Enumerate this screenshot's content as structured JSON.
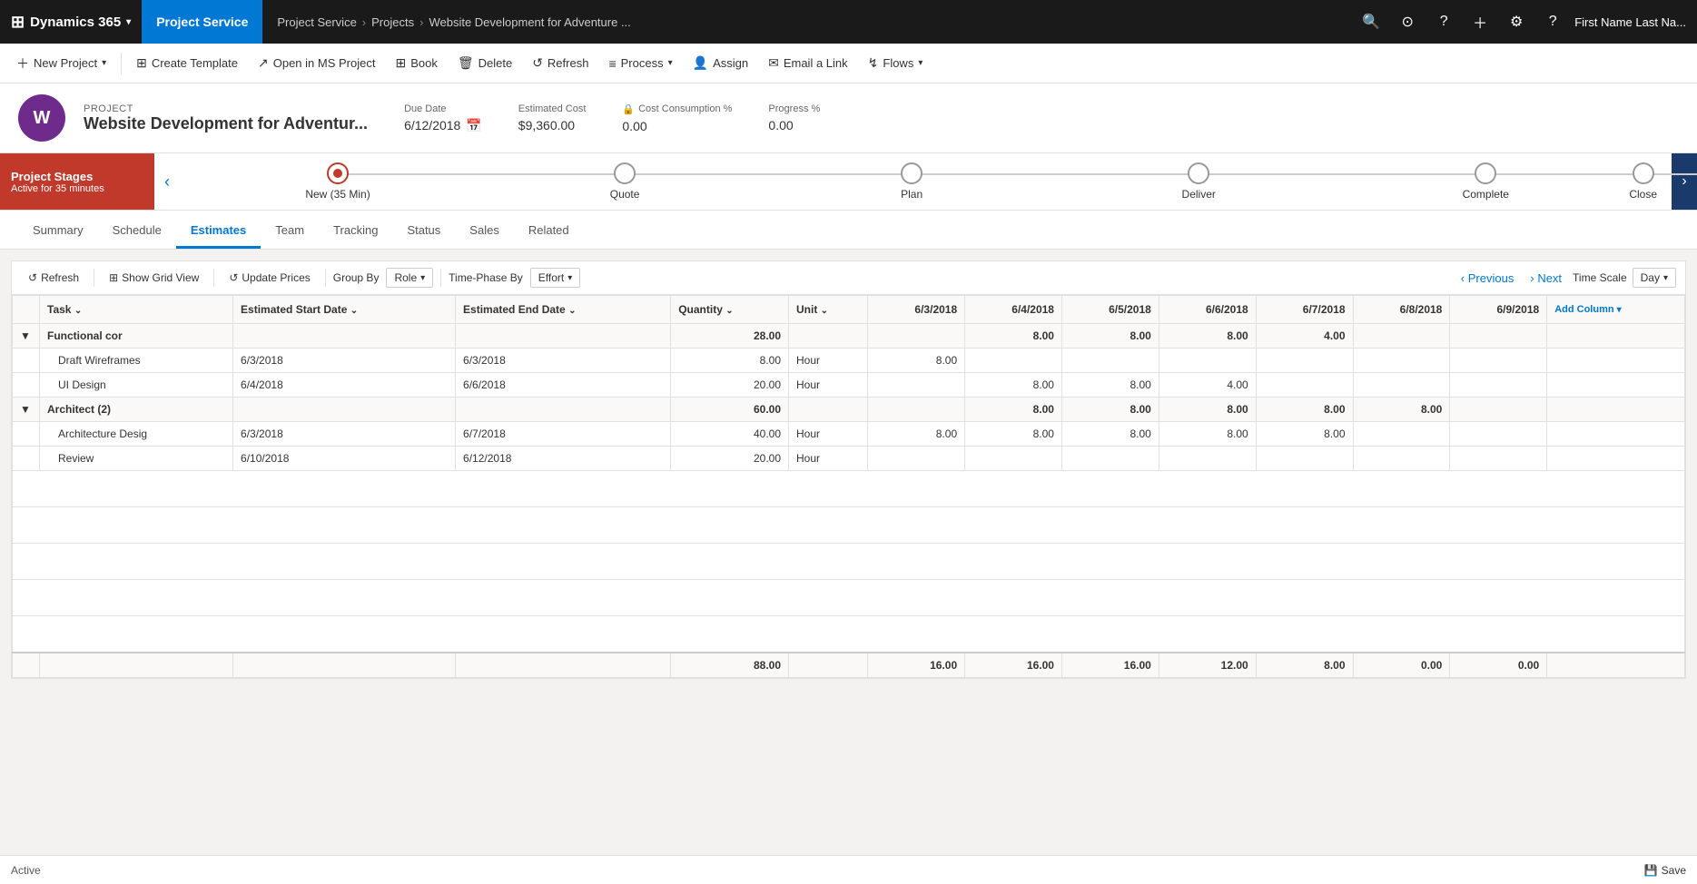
{
  "topnav": {
    "brand": "Dynamics 365",
    "brand_chevron": "▾",
    "module": "Project Service",
    "breadcrumb": [
      "Project Service",
      "Projects",
      "Website Development for Adventure ..."
    ],
    "icons": [
      "search",
      "favorite",
      "help",
      "plus"
    ],
    "settings_icon": "⚙",
    "question_icon": "?",
    "user": "First Name Last Na..."
  },
  "commands": [
    {
      "label": "New Project",
      "icon": "＋",
      "has_dropdown": true
    },
    {
      "label": "Create Template",
      "icon": "⊞"
    },
    {
      "label": "Open in MS Project",
      "icon": "↗"
    },
    {
      "label": "Book",
      "icon": "⊞"
    },
    {
      "label": "Delete",
      "icon": "🗑"
    },
    {
      "label": "Refresh",
      "icon": "↺"
    },
    {
      "label": "Process",
      "icon": "≡",
      "has_dropdown": true
    },
    {
      "label": "Assign",
      "icon": "👤"
    },
    {
      "label": "Email a Link",
      "icon": "✉"
    },
    {
      "label": "Flows",
      "icon": "↯",
      "has_dropdown": true
    }
  ],
  "project": {
    "label": "PROJECT",
    "title": "Website Development for Adventur...",
    "icon_letter": "W",
    "due_date_label": "Due Date",
    "due_date_value": "6/12/2018",
    "estimated_cost_label": "Estimated Cost",
    "estimated_cost_value": "$9,360.00",
    "cost_consumption_label": "Cost Consumption %",
    "cost_consumption_value": "0.00",
    "progress_label": "Progress %",
    "progress_value": "0.00"
  },
  "stages": {
    "panel_title": "Project Stages",
    "panel_sub": "Active for 35 minutes",
    "items": [
      {
        "name": "New (35 Min)",
        "active": true
      },
      {
        "name": "Quote",
        "active": false
      },
      {
        "name": "Plan",
        "active": false
      },
      {
        "name": "Deliver",
        "active": false
      },
      {
        "name": "Complete",
        "active": false
      },
      {
        "name": "Close",
        "active": false
      }
    ]
  },
  "tabs": [
    "Summary",
    "Schedule",
    "Estimates",
    "Team",
    "Tracking",
    "Status",
    "Sales",
    "Related"
  ],
  "active_tab": "Estimates",
  "estimates_toolbar": {
    "refresh": "Refresh",
    "show_grid_view": "Show Grid View",
    "update_prices": "Update Prices",
    "group_by_label": "Group By",
    "group_by_value": "Role",
    "time_phase_label": "Time-Phase By",
    "time_phase_value": "Effort",
    "previous": "Previous",
    "next": "Next",
    "time_scale_label": "Time Scale",
    "time_scale_value": "Day"
  },
  "grid": {
    "columns": [
      {
        "label": "",
        "key": "expand"
      },
      {
        "label": "Task",
        "key": "task"
      },
      {
        "label": "Estimated Start Date",
        "key": "start_date"
      },
      {
        "label": "Estimated End Date",
        "key": "end_date"
      },
      {
        "label": "Quantity",
        "key": "quantity"
      },
      {
        "label": "Unit",
        "key": "unit"
      },
      {
        "label": "6/3/2018",
        "key": "d1"
      },
      {
        "label": "6/4/2018",
        "key": "d2"
      },
      {
        "label": "6/5/2018",
        "key": "d3"
      },
      {
        "label": "6/6/2018",
        "key": "d4"
      },
      {
        "label": "6/7/2018",
        "key": "d5"
      },
      {
        "label": "6/8/2018",
        "key": "d6"
      },
      {
        "label": "6/9/2018",
        "key": "d7"
      },
      {
        "label": "Add Column",
        "key": "add"
      }
    ],
    "rows": [
      {
        "type": "group",
        "expand": "▼",
        "task": "Functional cor",
        "start_date": "",
        "end_date": "",
        "quantity": "28.00",
        "unit": "",
        "d1": "",
        "d2": "8.00",
        "d3": "8.00",
        "d4": "8.00",
        "d5": "4.00",
        "d6": "",
        "d7": "",
        "add": ""
      },
      {
        "type": "data",
        "expand": "",
        "task": "Draft Wireframes",
        "start_date": "6/3/2018",
        "end_date": "6/3/2018",
        "quantity": "8.00",
        "unit": "Hour",
        "d1": "8.00",
        "d2": "",
        "d3": "",
        "d4": "",
        "d5": "",
        "d6": "",
        "d7": "",
        "add": ""
      },
      {
        "type": "data",
        "expand": "",
        "task": "UI Design",
        "start_date": "6/4/2018",
        "end_date": "6/6/2018",
        "quantity": "20.00",
        "unit": "Hour",
        "d1": "",
        "d2": "8.00",
        "d3": "8.00",
        "d4": "4.00",
        "d5": "",
        "d6": "",
        "d7": "",
        "add": ""
      },
      {
        "type": "group",
        "expand": "▼",
        "task": "Architect (2)",
        "start_date": "",
        "end_date": "",
        "quantity": "60.00",
        "unit": "",
        "d1": "",
        "d2": "8.00",
        "d3": "8.00",
        "d4": "8.00",
        "d5": "8.00",
        "d6": "8.00",
        "d7": "",
        "add": ""
      },
      {
        "type": "data",
        "expand": "",
        "task": "Architecture Desig",
        "start_date": "6/3/2018",
        "end_date": "6/7/2018",
        "quantity": "40.00",
        "unit": "Hour",
        "d1": "8.00",
        "d2": "8.00",
        "d3": "8.00",
        "d4": "8.00",
        "d5": "8.00",
        "d6": "",
        "d7": "",
        "add": ""
      },
      {
        "type": "data",
        "expand": "",
        "task": "Review",
        "start_date": "6/10/2018",
        "end_date": "6/12/2018",
        "quantity": "20.00",
        "unit": "Hour",
        "d1": "",
        "d2": "",
        "d3": "",
        "d4": "",
        "d5": "",
        "d6": "",
        "d7": "",
        "add": ""
      }
    ],
    "totals": {
      "quantity": "88.00",
      "d1": "16.00",
      "d2": "16.00",
      "d3": "16.00",
      "d4": "12.00",
      "d5": "8.00",
      "d6": "0.00",
      "d7": "0.00"
    }
  },
  "statusbar": {
    "status": "Active",
    "save_icon": "💾",
    "save_label": "Save"
  }
}
